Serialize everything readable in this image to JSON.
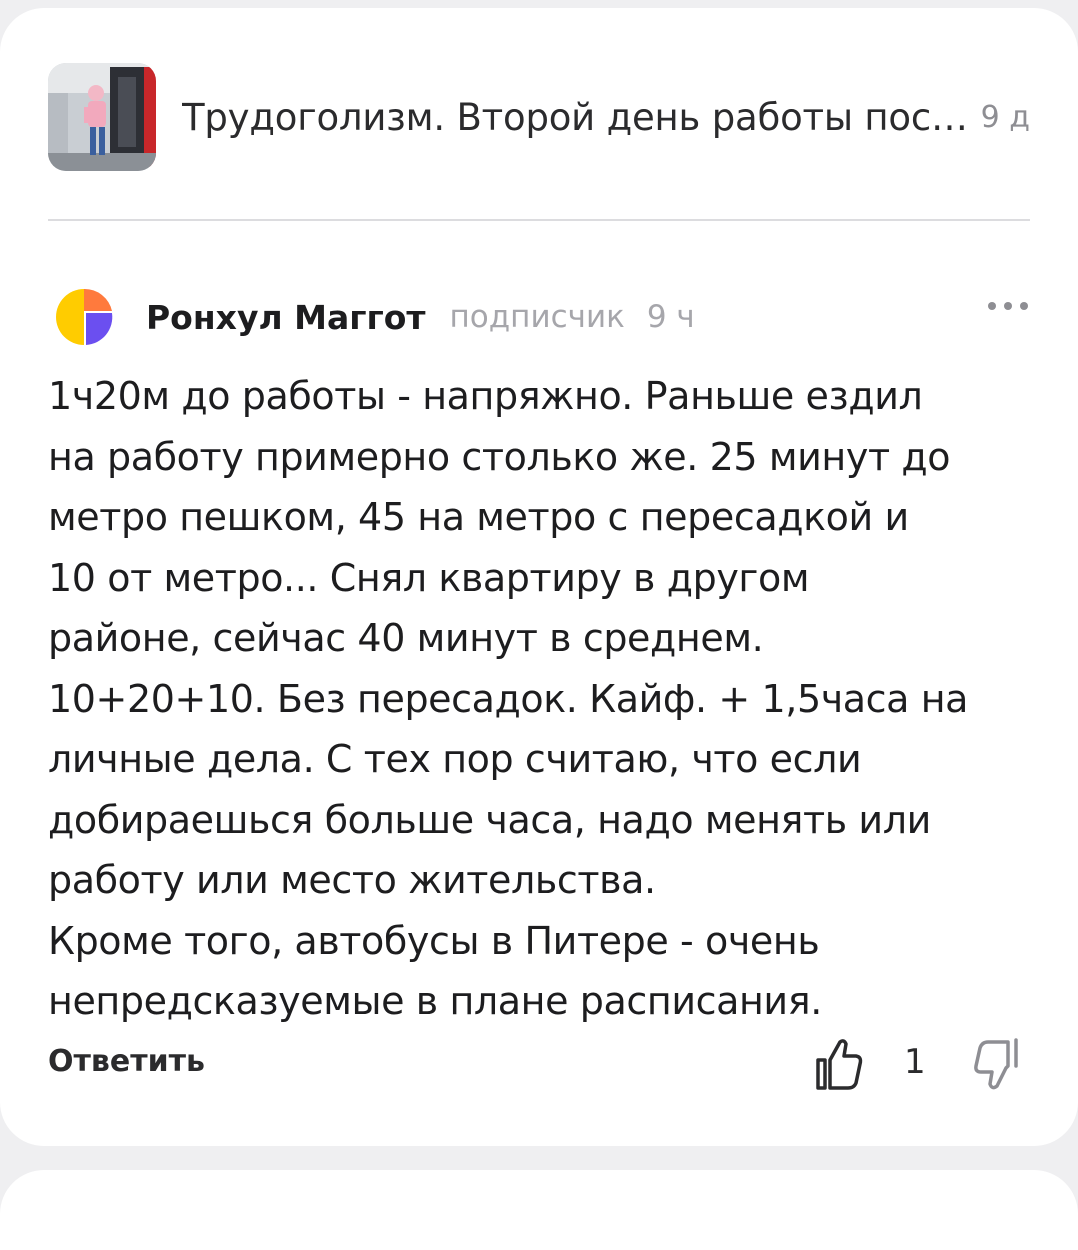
{
  "post": {
    "title": "Трудоголизм. Второй день работы после отпуска",
    "age": "9 д"
  },
  "comment": {
    "author": "Ронхул Маггот",
    "role": "подписчик",
    "time": "9 ч",
    "text": "1ч20м до работы - напряжно. Раньше ездил\nна работу примерно столько же. 25 минут до\nметро пешком, 45 на метро с пересадкой и\n10 от метро... Снял квартиру в другом\nрайоне, сейчас 40 минут в среднем.\n10+20+10. Без пересадок. Кайф. + 1,5часа на\nличные дела. С тех пор считаю, что если\nдобираешься больше часа, надо менять или\nработу или место жительства.\nКроме того, автобусы в Питере - очень\nнепредсказуемые в плане расписания.",
    "reply_label": "Ответить",
    "likes": "1"
  },
  "icons": {
    "more": "more-dots-icon",
    "like": "thumb-up-icon",
    "dislike": "thumb-down-icon",
    "avatar": "user-avatar-icon"
  },
  "colors": {
    "background": "#efeff1",
    "card": "#ffffff",
    "text": "#1d1d1f",
    "muted": "#a6a6ab",
    "avatar_yellow": "#ffcc00",
    "avatar_purple": "#6b4ff0",
    "avatar_orange": "#ff7a3d"
  }
}
